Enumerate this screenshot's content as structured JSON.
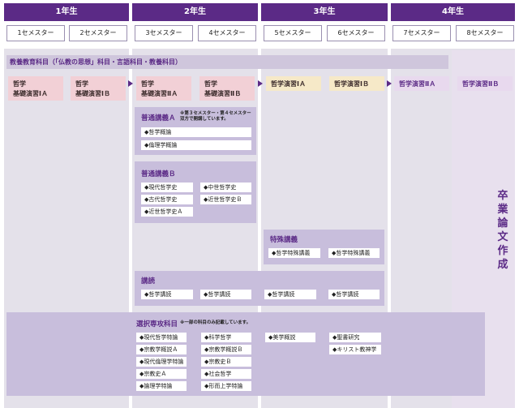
{
  "years": [
    "1年生",
    "2年生",
    "3年生",
    "4年生"
  ],
  "semesters": [
    "1セメスター",
    "2セメスター",
    "3セメスター",
    "4セメスター",
    "5セメスター",
    "6セメスター",
    "7セメスター",
    "8セメスター"
  ],
  "general_education": "教養教育科目（「仏教の思想」科目・言語科目・教養科目）",
  "seminars": [
    {
      "line1": "哲学",
      "line2": "基礎演習ⅠＡ"
    },
    {
      "line1": "哲学",
      "line2": "基礎演習ⅠＢ"
    },
    {
      "line1": "哲学",
      "line2": "基礎演習ⅡＡ"
    },
    {
      "line1": "哲学",
      "line2": "基礎演習ⅡＢ"
    },
    {
      "line1": "哲学演習ⅠＡ"
    },
    {
      "line1": "哲学演習ⅠＢ"
    },
    {
      "line1": "哲学演習ⅡＡ"
    },
    {
      "line1": "哲学演習ⅡＢ"
    }
  ],
  "lecture_a": {
    "title": "普通講義Ａ",
    "note1": "※第３セメスター・第４セメスター",
    "note2": "双方で開講しています。",
    "items": [
      "◆哲学概論",
      "◆倫理学概論"
    ]
  },
  "lecture_b": {
    "title": "普通講義Ｂ",
    "items": [
      "◆現代哲学史",
      "◆中世哲学史",
      "◆古代哲学史",
      "◆近世哲学史Ｂ",
      "◆近世哲学史Ａ"
    ]
  },
  "special_lecture": {
    "title": "特殊講義",
    "items": [
      "◆哲学特殊講義",
      "◆哲学特殊講義"
    ]
  },
  "reading": {
    "title": "講読",
    "items": [
      "◆哲学講読",
      "◆哲学講読",
      "◆哲学講読",
      "◆哲学講読"
    ]
  },
  "elective": {
    "title": "選択専攻科目",
    "note": "※一部の科目のみ記載しています。",
    "items": [
      "◆現代哲学特論",
      "◆科学哲学",
      "◆美学概説",
      "◆聖書研究",
      "◆宗教学概説Ａ",
      "◆宗教学概説Ｂ",
      "◆キリスト教神学",
      "◆現代倫理学特論",
      "◆宗教史Ｂ",
      "◆宗教史Ａ",
      "◆社会哲学",
      "◆論理学特論",
      "◆形而上学特論"
    ]
  },
  "thesis": [
    "卒",
    "業",
    "論",
    "文",
    "作",
    "成"
  ]
}
